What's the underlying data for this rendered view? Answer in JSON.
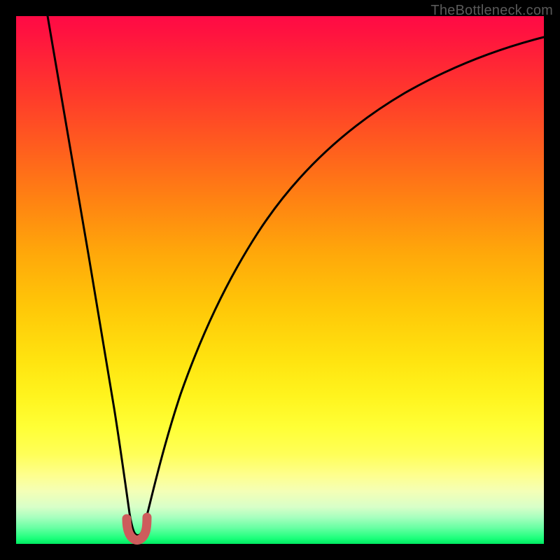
{
  "watermark": "TheBottleneck.com",
  "chart_data": {
    "type": "line",
    "title": "",
    "xlabel": "",
    "ylabel": "",
    "xlim": [
      0,
      100
    ],
    "ylim": [
      0,
      100
    ],
    "series": [
      {
        "name": "bottleneck-curve",
        "x": [
          6,
          8,
          10,
          12,
          14,
          16,
          18,
          20,
          21,
          22,
          23,
          24,
          26,
          28,
          30,
          34,
          38,
          42,
          48,
          55,
          62,
          70,
          78,
          86,
          94,
          100
        ],
        "values": [
          100,
          88,
          75,
          62,
          48,
          34,
          20,
          8,
          3,
          1,
          1,
          3,
          10,
          20,
          30,
          45,
          56,
          64,
          73,
          80,
          85,
          89,
          92,
          94,
          96,
          97
        ]
      }
    ],
    "marker": {
      "name": "optimal-point",
      "x": 22,
      "y": 2,
      "color": "#cd5c5c"
    },
    "gradient_stops": [
      {
        "pos": 0,
        "color": "#ff0a45"
      },
      {
        "pos": 50,
        "color": "#ffc708"
      },
      {
        "pos": 80,
        "color": "#ffff58"
      },
      {
        "pos": 100,
        "color": "#00e860"
      }
    ]
  }
}
